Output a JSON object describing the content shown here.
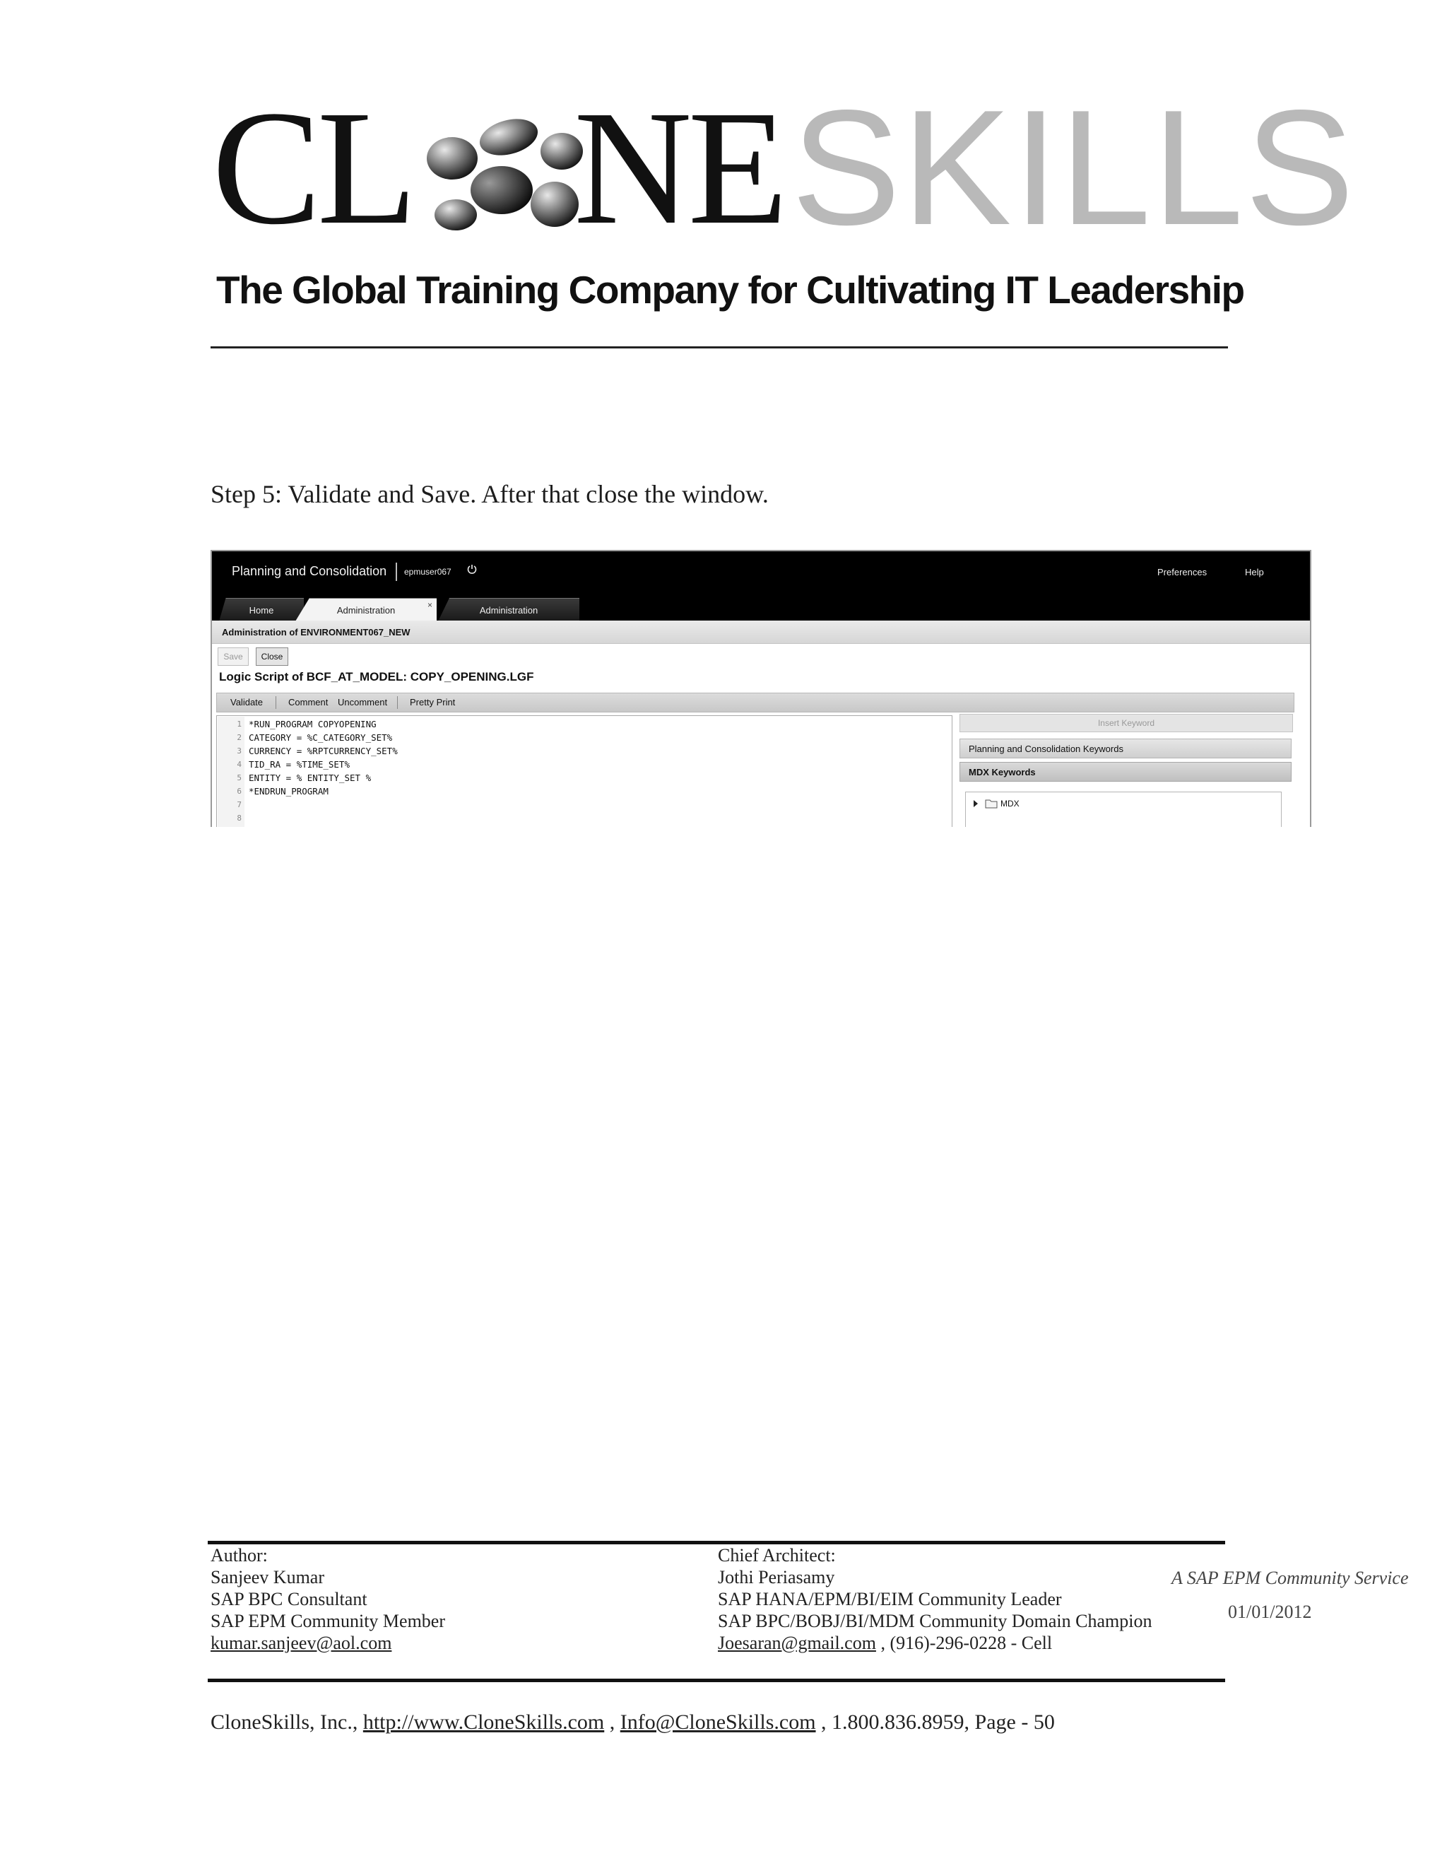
{
  "header": {
    "logo_text": "CLONESKILLS",
    "tagline": "The Global Training Company for Cultivating IT Leadership"
  },
  "step_text": "Step 5: Validate and Save. After that close the window.",
  "screenshot": {
    "app_title": "Planning and Consolidation",
    "user": "epmuser067",
    "preferences": "Preferences",
    "help": "Help",
    "tabs": [
      {
        "label": "Home"
      },
      {
        "label": "Administration",
        "close": "×"
      },
      {
        "label": "Administration"
      }
    ],
    "subheader": "Administration of ENVIRONMENT067_NEW",
    "save_label": "Save",
    "close_label": "Close",
    "script_title": "Logic Script of BCF_AT_MODEL: COPY_OPENING.LGF",
    "toolbar": {
      "validate": "Validate",
      "comment": "Comment",
      "uncomment": "Uncomment",
      "pretty_print": "Pretty Print"
    },
    "code_lines": [
      {
        "n": "1",
        "text": "*RUN_PROGRAM COPYOPENING"
      },
      {
        "n": "2",
        "text": "CATEGORY = %C_CATEGORY_SET%"
      },
      {
        "n": "3",
        "text": "CURRENCY = %RPTCURRENCY_SET%"
      },
      {
        "n": "4",
        "text": "TID_RA = %TIME_SET%"
      },
      {
        "n": "5",
        "text": "ENTITY = % ENTITY_SET %"
      },
      {
        "n": "6",
        "text": "*ENDRUN_PROGRAM"
      },
      {
        "n": "7",
        "text": ""
      },
      {
        "n": "8",
        "text": ""
      }
    ],
    "keywords": {
      "insert": "Insert Keyword",
      "pc_keywords": "Planning and Consolidation Keywords",
      "mdx_keywords": "MDX Keywords",
      "tree_item": "MDX"
    }
  },
  "footer": {
    "author_label": "Author:",
    "author_name": "Sanjeev Kumar",
    "author_title1": "SAP BPC Consultant",
    "author_title2": "SAP EPM Community Member",
    "author_email": "kumar.sanjeev@aol.com",
    "architect_label": "Chief Architect:",
    "architect_name": "Jothi Periasamy",
    "architect_title1": "SAP HANA/EPM/BI/EIM Community Leader",
    "architect_title2": "SAP BPC/BOBJ/BI/MDM Community Domain Champion",
    "architect_email": "Joesaran@gmail.com",
    "architect_phone": ", (916)-296-0228 - Cell",
    "community_service": "A SAP EPM Community Service",
    "date": "01/01/2012",
    "company": "CloneSkills, Inc.,",
    "website": "http://www.CloneSkills.com",
    "sep": ",",
    "info_email": "Info@CloneSkills.com",
    "phone_page": ", 1.800.836.8959, Page - 50"
  }
}
